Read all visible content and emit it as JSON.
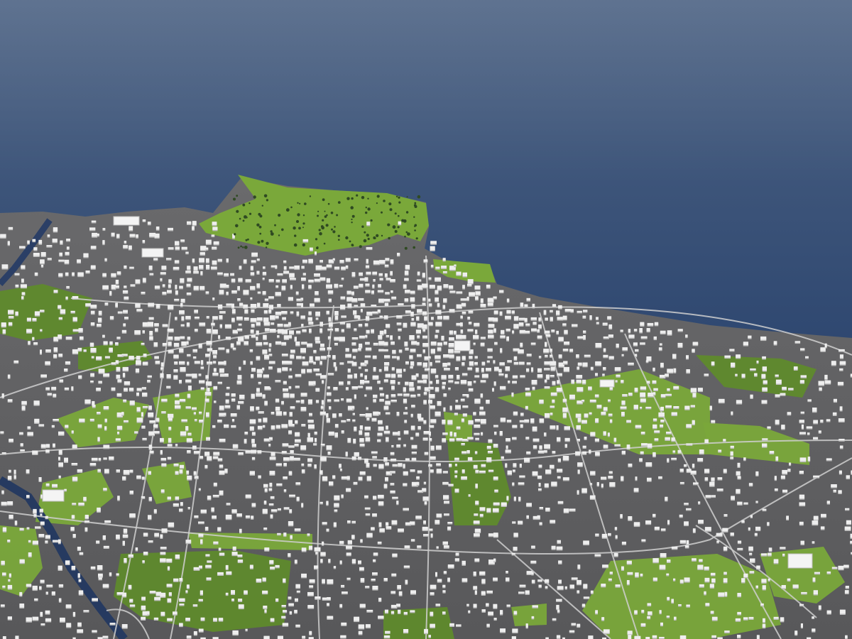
{
  "scene": {
    "kind": "3d-city-model-aerial",
    "colors": {
      "sea_top": "#40567a",
      "sea_horizon": "#5a6f8c",
      "sea_bottom": "#223c66",
      "ground": "#5d5d60",
      "ground_dark": "#4a4a4d",
      "park": "#7aa83a",
      "park_dark": "#5f8a2c",
      "building": "#eeeeee",
      "building_shade": "#bdbdbd",
      "road": "#cfcfcf",
      "river": "#2b3f66",
      "tree": "#2f4a22"
    }
  }
}
